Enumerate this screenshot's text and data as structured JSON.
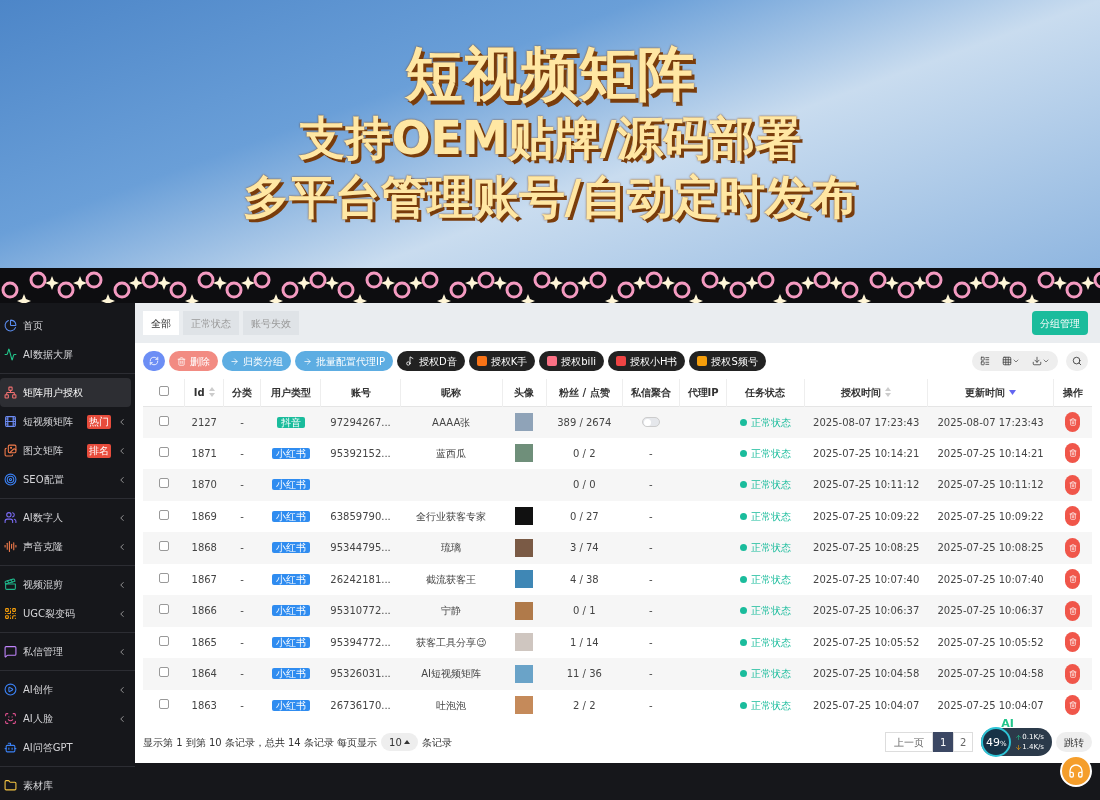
{
  "banner": {
    "title": "短视频矩阵",
    "lines": [
      "支持OEM贴牌/源码部署",
      "多平台管理账号/自动定时发布"
    ]
  },
  "sidebar": {
    "groups": [
      {
        "items": [
          {
            "label": "首页",
            "selected": false,
            "expandable": false
          },
          {
            "label": "AI数据大屏",
            "selected": false,
            "expandable": false
          }
        ]
      },
      {
        "items": [
          {
            "label": "矩阵用户授权",
            "selected": true,
            "expandable": false
          },
          {
            "label": "短视频矩阵",
            "selected": false,
            "expandable": true,
            "badge": "热门"
          },
          {
            "label": "图文矩阵",
            "selected": false,
            "expandable": true,
            "badge": "排名"
          },
          {
            "label": "SEO配置",
            "selected": false,
            "expandable": true
          }
        ]
      },
      {
        "items": [
          {
            "label": "AI数字人",
            "selected": false,
            "expandable": true
          },
          {
            "label": "声音克隆",
            "selected": false,
            "expandable": true
          }
        ]
      },
      {
        "items": [
          {
            "label": "视频混剪",
            "selected": false,
            "expandable": true
          },
          {
            "label": "UGC裂变码",
            "selected": false,
            "expandable": true
          }
        ]
      },
      {
        "items": [
          {
            "label": "私信管理",
            "selected": false,
            "expandable": true
          }
        ]
      },
      {
        "items": [
          {
            "label": "AI创作",
            "selected": false,
            "expandable": true
          },
          {
            "label": "AI人脸",
            "selected": false,
            "expandable": true
          },
          {
            "label": "AI问答GPT",
            "selected": false,
            "expandable": false
          }
        ]
      },
      {
        "items": [
          {
            "label": "素材库",
            "selected": false,
            "expandable": false
          }
        ]
      }
    ]
  },
  "tabs": [
    {
      "label": "全部",
      "selected": true
    },
    {
      "label": "正常状态",
      "selected": false
    },
    {
      "label": "账号失效",
      "selected": false
    }
  ],
  "group_button": "分组管理",
  "toolbar": [
    {
      "kind": "refresh"
    },
    {
      "kind": "danger",
      "label": "删除"
    },
    {
      "kind": "info",
      "label": "归类分组"
    },
    {
      "kind": "info",
      "label": "批量配置代理IP"
    },
    {
      "kind": "auth",
      "label": "授权D音"
    },
    {
      "kind": "auth",
      "label": "授权K手"
    },
    {
      "kind": "auth",
      "label": "授权bili"
    },
    {
      "kind": "auth",
      "label": "授权小H书"
    },
    {
      "kind": "auth",
      "label": "授权S频号"
    }
  ],
  "table": {
    "header_checked": false,
    "columns": [
      {
        "label": "Id",
        "sortable": true,
        "sorted_desc": false
      },
      {
        "label": "分类",
        "sortable": false
      },
      {
        "label": "用户类型",
        "sortable": false
      },
      {
        "label": "账号",
        "sortable": false
      },
      {
        "label": "昵称",
        "sortable": false
      },
      {
        "label": "头像",
        "sortable": false
      },
      {
        "label": "粉丝 / 点赞",
        "sortable": false
      },
      {
        "label": "私信聚合",
        "sortable": false
      },
      {
        "label": "代理IP",
        "sortable": false
      },
      {
        "label": "任务状态",
        "sortable": false
      },
      {
        "label": "授权时间",
        "sortable": true,
        "sorted_desc": false
      },
      {
        "label": "更新时间",
        "sortable": true,
        "sorted_desc": true
      },
      {
        "label": "操作",
        "sortable": false
      }
    ],
    "rows": [
      {
        "checked": false,
        "id": "2127",
        "category": "-",
        "user_type": {
          "kind": "douyin",
          "label": "抖音"
        },
        "account": "97294267...",
        "nickname": "AAAA张",
        "avatar": true,
        "stats": "389 / 2674",
        "dm": {
          "kind": "toggle",
          "on": false
        },
        "status": "正常状态",
        "auth_time": "2025-08-07 17:23:43",
        "update_time": "2025-08-07 17:23:43"
      },
      {
        "checked": false,
        "id": "1871",
        "category": "-",
        "user_type": {
          "kind": "xhs",
          "label": "小红书"
        },
        "account": "95392152...",
        "nickname": "蓝西瓜",
        "avatar": true,
        "stats": "0 / 2",
        "dm": {
          "kind": "text",
          "text": "-"
        },
        "status": "正常状态",
        "auth_time": "2025-07-25 10:14:21",
        "update_time": "2025-07-25 10:14:21"
      },
      {
        "checked": false,
        "id": "1870",
        "category": "-",
        "user_type": {
          "kind": "xhs",
          "label": "小红书"
        },
        "avatar": false,
        "stats": "0 / 0",
        "dm": {
          "kind": "text",
          "text": "-"
        },
        "status": "正常状态",
        "auth_time": "2025-07-25 10:11:12",
        "update_time": "2025-07-25 10:11:12"
      },
      {
        "checked": false,
        "id": "1869",
        "category": "-",
        "user_type": {
          "kind": "xhs",
          "label": "小红书"
        },
        "account": "63859790...",
        "nickname": "全行业获客专家",
        "avatar": true,
        "stats": "0 / 27",
        "dm": {
          "kind": "text",
          "text": "-"
        },
        "status": "正常状态",
        "auth_time": "2025-07-25 10:09:22",
        "update_time": "2025-07-25 10:09:22"
      },
      {
        "checked": false,
        "id": "1868",
        "category": "-",
        "user_type": {
          "kind": "xhs",
          "label": "小红书"
        },
        "account": "95344795...",
        "nickname": "琉璃",
        "avatar": true,
        "stats": "3 / 74",
        "dm": {
          "kind": "text",
          "text": "-"
        },
        "status": "正常状态",
        "auth_time": "2025-07-25 10:08:25",
        "update_time": "2025-07-25 10:08:25"
      },
      {
        "checked": false,
        "id": "1867",
        "category": "-",
        "user_type": {
          "kind": "xhs",
          "label": "小红书"
        },
        "account": "26242181...",
        "nickname": "截流获客王",
        "avatar": true,
        "stats": "4 / 38",
        "dm": {
          "kind": "text",
          "text": "-"
        },
        "status": "正常状态",
        "auth_time": "2025-07-25 10:07:40",
        "update_time": "2025-07-25 10:07:40"
      },
      {
        "checked": false,
        "id": "1866",
        "category": "-",
        "user_type": {
          "kind": "xhs",
          "label": "小红书"
        },
        "account": "95310772...",
        "nickname": "宁静",
        "avatar": true,
        "stats": "0 / 1",
        "dm": {
          "kind": "text",
          "text": "-"
        },
        "status": "正常状态",
        "auth_time": "2025-07-25 10:06:37",
        "update_time": "2025-07-25 10:06:37"
      },
      {
        "checked": false,
        "id": "1865",
        "category": "-",
        "user_type": {
          "kind": "xhs",
          "label": "小红书"
        },
        "account": "95394772...",
        "nickname": "获客工具分享😉",
        "avatar": true,
        "stats": "1 / 14",
        "dm": {
          "kind": "text",
          "text": "-"
        },
        "status": "正常状态",
        "auth_time": "2025-07-25 10:05:52",
        "update_time": "2025-07-25 10:05:52"
      },
      {
        "checked": false,
        "id": "1864",
        "category": "-",
        "user_type": {
          "kind": "xhs",
          "label": "小红书"
        },
        "account": "95326031...",
        "nickname": "AI短视频矩阵",
        "avatar": true,
        "stats": "11 / 36",
        "dm": {
          "kind": "text",
          "text": "-"
        },
        "status": "正常状态",
        "auth_time": "2025-07-25 10:04:58",
        "update_time": "2025-07-25 10:04:58"
      },
      {
        "checked": false,
        "id": "1863",
        "category": "-",
        "user_type": {
          "kind": "xhs",
          "label": "小红书"
        },
        "account": "26736170...",
        "nickname": "吐泡泡",
        "avatar": true,
        "stats": "2 / 2",
        "dm": {
          "kind": "text",
          "text": "-"
        },
        "status": "正常状态",
        "auth_time": "2025-07-25 10:04:07",
        "update_time": "2025-07-25 10:04:07"
      }
    ]
  },
  "footer": {
    "summary": "显示第 1 到第 10 条记录，总共 14 条记录 每页显示",
    "page_size": "10",
    "suffix": "条记录"
  },
  "pagination": {
    "prev": "上一页",
    "pages": [
      {
        "label": "1",
        "selected": true
      },
      {
        "label": "2",
        "selected": false
      }
    ],
    "jump": "跳转"
  },
  "speed_widget": {
    "badge": "AI",
    "percent": "49",
    "unit": "%",
    "up": "0.1K/s",
    "down": "1.4K/s"
  }
}
